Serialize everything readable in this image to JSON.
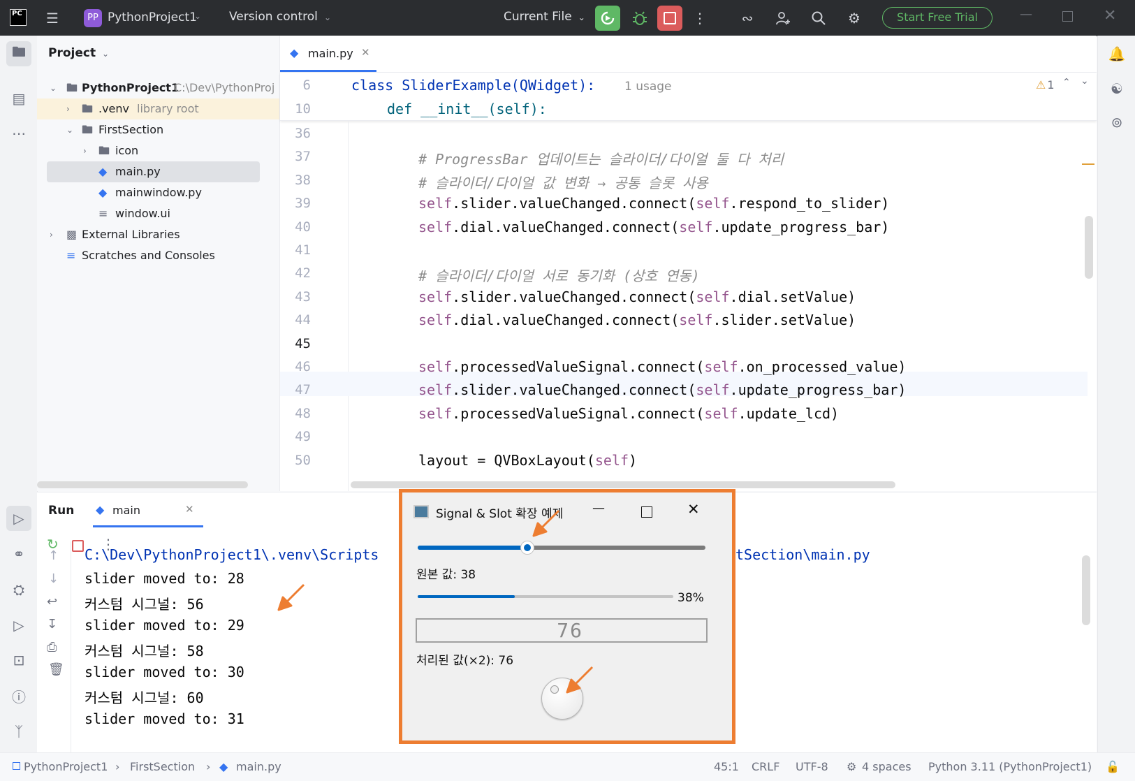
{
  "titlebar": {
    "app_badge": "PC",
    "project_badge": "PP",
    "project_name": "PythonProject1",
    "vcs": "Version control",
    "run_config": "Current File",
    "trial_button": "Start Free Trial"
  },
  "project_panel": {
    "title": "Project",
    "items": [
      {
        "label": "PythonProject1",
        "hint": "C:\\Dev\\PythonProj"
      },
      {
        "label": ".venv",
        "hint": "library root"
      },
      {
        "label": "FirstSection",
        "hint": ""
      },
      {
        "label": "icon",
        "hint": ""
      },
      {
        "label": "main.py",
        "hint": ""
      },
      {
        "label": "mainwindow.py",
        "hint": ""
      },
      {
        "label": "window.ui",
        "hint": ""
      },
      {
        "label": "External Libraries",
        "hint": ""
      },
      {
        "label": "Scratches and Consoles",
        "hint": ""
      }
    ]
  },
  "editor": {
    "tab": "main.py",
    "sticky": [
      {
        "line": "6",
        "text": "class SliderExample(QWidget):",
        "usage": "1 usage"
      },
      {
        "line": "10",
        "text": "def __init__(self):"
      }
    ],
    "warnings": "1",
    "lines": [
      {
        "n": "36"
      },
      {
        "n": "37",
        "comment": "# ProgressBar 업데이트는 슬라이더/다이얼 둘 다 처리"
      },
      {
        "n": "38",
        "comment": "# 슬라이더/다이얼 값 변화 → 공통 슬롯 사용"
      },
      {
        "n": "39",
        "self1": "self",
        "mid": ".slider.valueChanged.connect(",
        "self2": "self",
        "end": ".respond_to_slider)"
      },
      {
        "n": "40",
        "self1": "self",
        "mid": ".dial.valueChanged.connect(",
        "self2": "self",
        "end": ".update_progress_bar)"
      },
      {
        "n": "41"
      },
      {
        "n": "42",
        "comment": "# 슬라이더/다이얼 서로 동기화 (상호 연동)"
      },
      {
        "n": "43",
        "self1": "self",
        "mid": ".slider.valueChanged.connect(",
        "self2": "self",
        "end": ".dial.setValue)"
      },
      {
        "n": "44",
        "self1": "self",
        "mid": ".dial.valueChanged.connect(",
        "self2": "self",
        "end": ".slider.setValue)"
      },
      {
        "n": "45"
      },
      {
        "n": "46",
        "self1": "self",
        "mid": ".processedValueSignal.connect(",
        "self2": "self",
        "end": ".on_processed_value)"
      },
      {
        "n": "47",
        "self1": "self",
        "mid": ".slider.valueChanged.connect(",
        "self2": "self",
        "end": ".update_progress_bar)"
      },
      {
        "n": "48",
        "self1": "self",
        "mid": ".processedValueSignal.connect(",
        "self2": "self",
        "end": ".update_lcd)"
      },
      {
        "n": "49"
      },
      {
        "n": "50",
        "mid": "layout = QVBoxLayout(",
        "self2": "self",
        "end": ")"
      }
    ]
  },
  "run_panel": {
    "title": "Run",
    "tab": "main",
    "output": [
      "C:\\Dev\\PythonProject1\\.venv\\Scripts",
      "tSection\\main.py",
      "slider moved to: 28",
      "커스텀 시그널: 56",
      "slider moved to: 29",
      "커스텀 시그널: 58",
      "slider moved to: 30",
      "커스텀 시그널: 60",
      "slider moved to: 31"
    ]
  },
  "qt_window": {
    "title": "Signal & Slot 확장 예제",
    "slider_value": 38,
    "raw_label": "원본 값: 38",
    "progress_text": "38%",
    "progress_value": 38,
    "lcd_text": "76",
    "processed_label": "처리된 값(×2): 76"
  },
  "statusbar": {
    "breadcrumb": [
      "PythonProject1",
      "FirstSection",
      "main.py"
    ],
    "position": "45:1",
    "line_sep": "CRLF",
    "encoding": "UTF-8",
    "indent": "4 spaces",
    "interpreter": "Python 3.11 (PythonProject1)"
  },
  "colors": {
    "accent": "#3574f0",
    "highlight": "#ed7d31",
    "run_green": "#5fb865",
    "stop_red": "#db5c5c"
  }
}
